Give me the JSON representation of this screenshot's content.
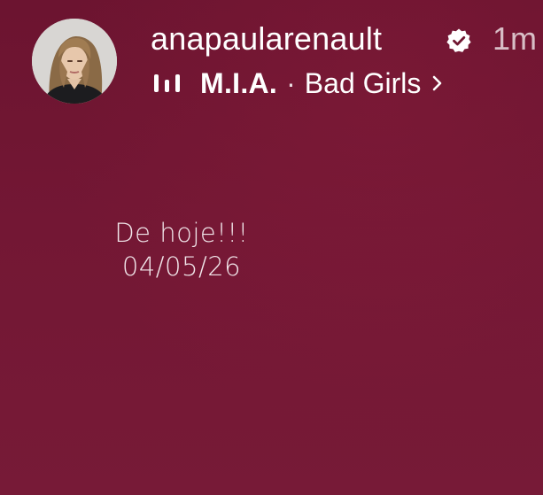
{
  "story": {
    "username": "anapaularenault",
    "time_ago": "1m",
    "verified_icon": "verified-badge-icon",
    "music": {
      "icon": "music-bars-icon",
      "artist": "M.I.A.",
      "separator": "·",
      "song": "Bad Girls",
      "chevron": "chevron-right-icon"
    },
    "caption": {
      "line1": "De hoje!!!",
      "line2": "04/05/26"
    }
  },
  "colors": {
    "background": "#701631",
    "text": "#ffffff"
  }
}
